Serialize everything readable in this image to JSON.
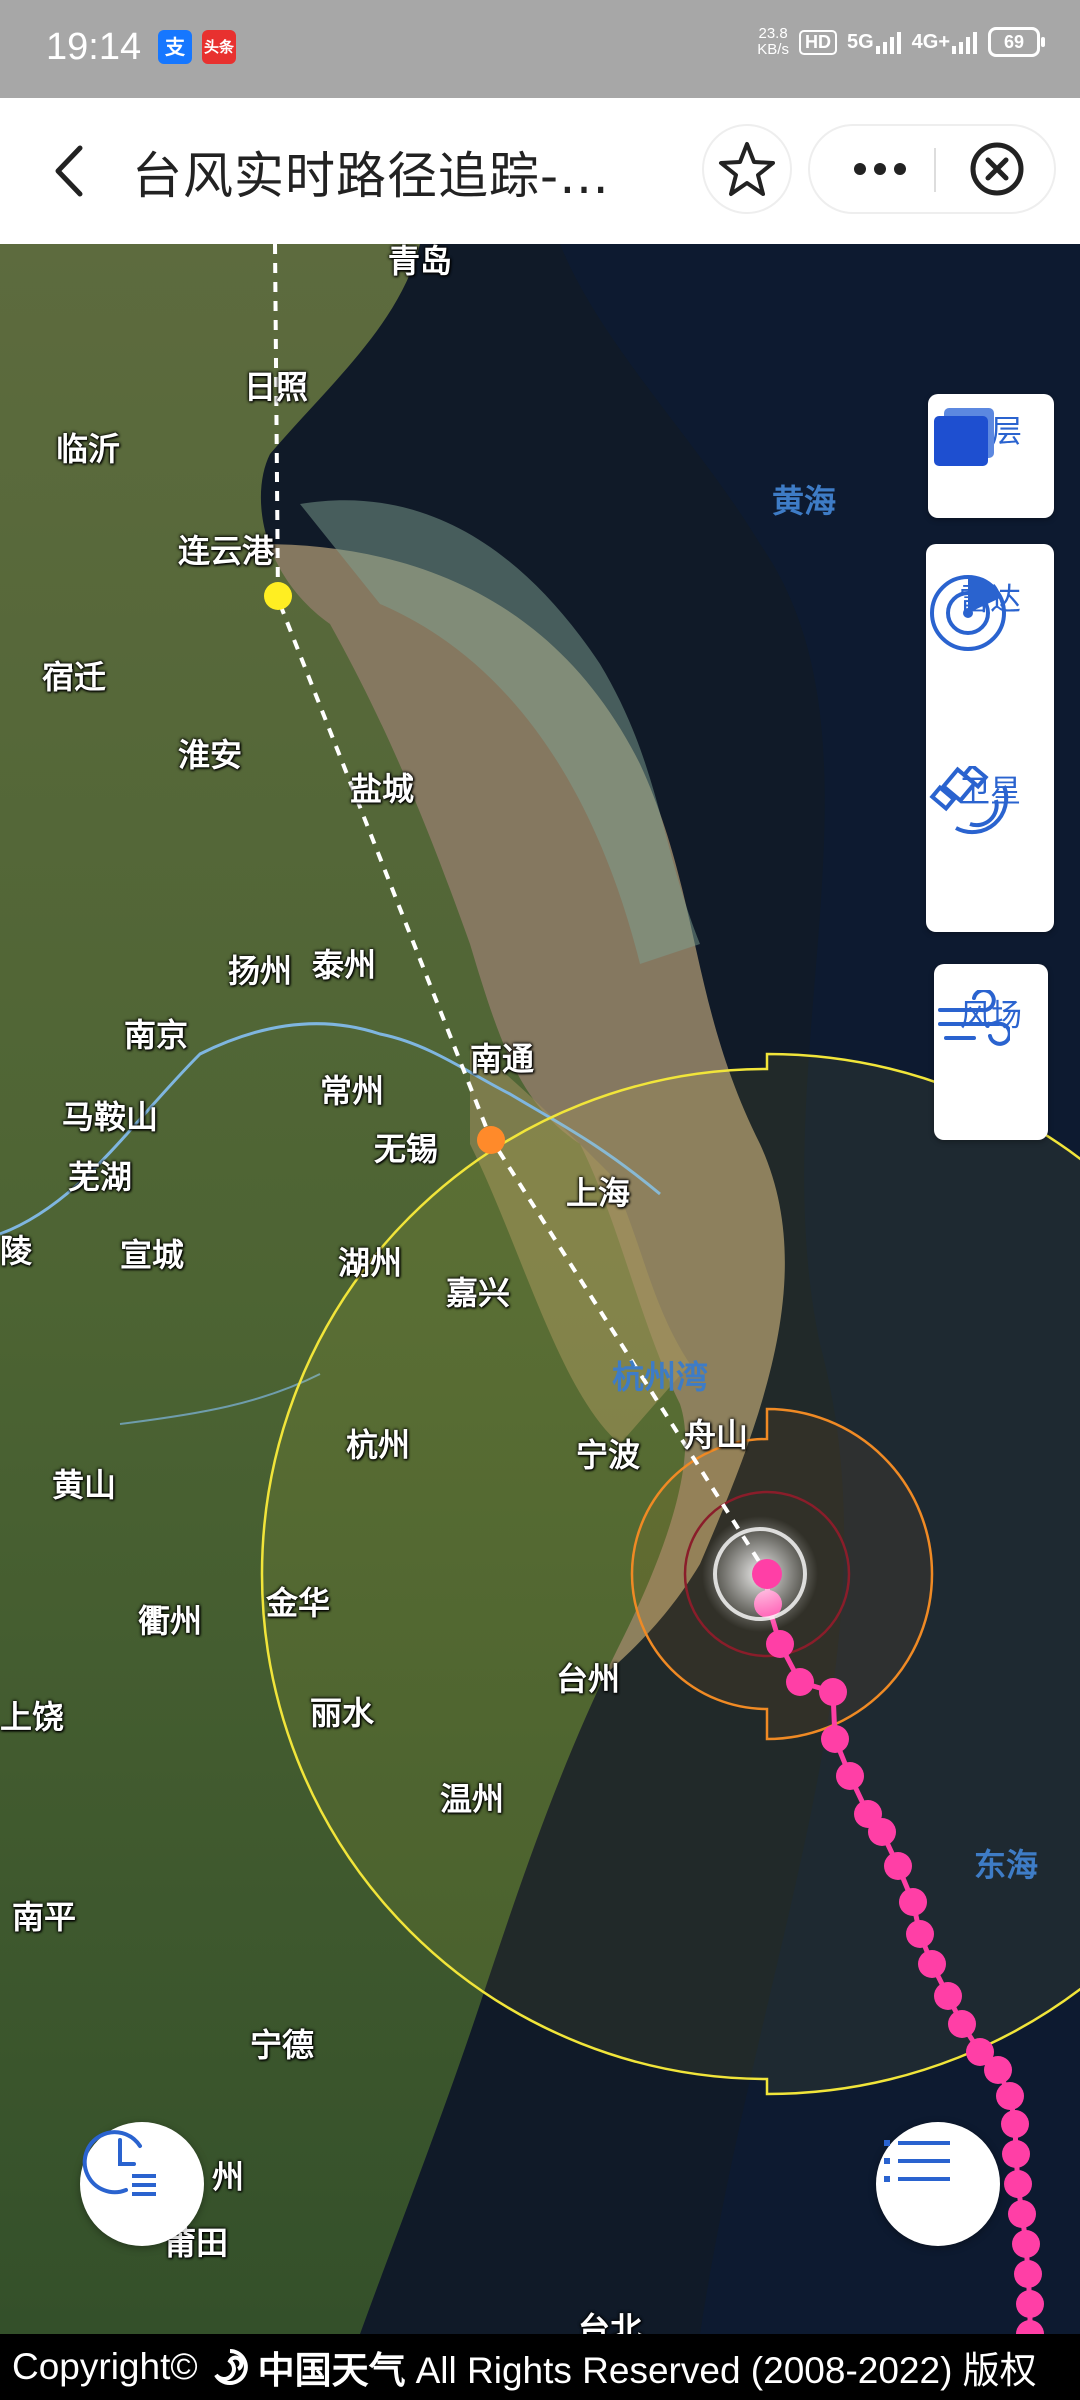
{
  "status_bar": {
    "time": "19:14",
    "app_badge_1": "支",
    "app_badge_2": "头条",
    "net_speed_value": "23.8",
    "net_speed_unit": "KB/s",
    "hd_label": "HD",
    "network_5g": "5G",
    "network_4g": "4G+",
    "battery": "69"
  },
  "header": {
    "title": "台风实时路径追踪-…"
  },
  "map": {
    "cities": [
      {
        "name": "青岛"
      },
      {
        "name": "日照"
      },
      {
        "name": "临沂"
      },
      {
        "name": "连云港"
      },
      {
        "name": "宿迁"
      },
      {
        "name": "淮安"
      },
      {
        "name": "盐城"
      },
      {
        "name": "扬州"
      },
      {
        "name": "泰州"
      },
      {
        "name": "南京"
      },
      {
        "name": "南通"
      },
      {
        "name": "马鞍山"
      },
      {
        "name": "常州"
      },
      {
        "name": "芜湖"
      },
      {
        "name": "无锡"
      },
      {
        "name": "上海"
      },
      {
        "name": "陵"
      },
      {
        "name": "宣城"
      },
      {
        "name": "湖州"
      },
      {
        "name": "嘉兴"
      },
      {
        "name": "杭州"
      },
      {
        "name": "宁波"
      },
      {
        "name": "舟山"
      },
      {
        "name": "黄山"
      },
      {
        "name": "衢州"
      },
      {
        "name": "金华"
      },
      {
        "name": "台州"
      },
      {
        "name": "丽水"
      },
      {
        "name": "上饶"
      },
      {
        "name": "温州"
      },
      {
        "name": "南平"
      },
      {
        "name": "宁德"
      },
      {
        "name": "州"
      },
      {
        "name": "莆田"
      },
      {
        "name": "台北"
      }
    ],
    "seas": {
      "yellow_sea": "黄海",
      "east_sea": "东海",
      "hangzhou_bay": "杭州湾"
    },
    "track_colors": {
      "history": "#ff3fa6",
      "forecast": "#ffffff",
      "wind_7": "#f1e53a",
      "wind_10": "#f08a24",
      "wind_12": "#8a1d2a"
    }
  },
  "controls": {
    "layers": {
      "label": "图层",
      "icon": "layers-icon"
    },
    "radar": {
      "label": "雷达",
      "icon": "radar-icon"
    },
    "satellite": {
      "label": "卫星",
      "icon": "satellite-icon"
    },
    "wind": {
      "label": "风场",
      "icon": "wind-icon"
    }
  },
  "footer": {
    "copyright_prefix": "Copyright©",
    "brand": "中国天气",
    "rights": "All Rights Reserved (2008-2022) 版权"
  }
}
